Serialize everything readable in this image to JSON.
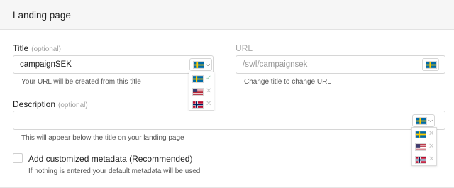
{
  "header": {
    "title": "Landing page"
  },
  "title_field": {
    "label": "Title",
    "optional": "(optional)",
    "value": "campaignSEK",
    "hint": "Your URL will be created from this title"
  },
  "url_field": {
    "label": "URL",
    "placeholder": "/sv/l/campaignsek",
    "hint": "Change title to change URL"
  },
  "description_field": {
    "label": "Description",
    "optional": "(optional)",
    "value": "",
    "hint": "This will appear below the title on your landing page"
  },
  "metadata": {
    "label": "Add customized metadata (Recommended)",
    "hint": "If nothing is entered your default metadata will be used",
    "checked": false
  },
  "languages": [
    {
      "icon": "sweden-flag-icon",
      "status": "done"
    },
    {
      "icon": "usa-flag-icon",
      "status": "missing"
    },
    {
      "icon": "norway-flag-icon",
      "status": "missing"
    }
  ],
  "status_marks": {
    "done": "✓",
    "missing": "✕"
  },
  "colors": {
    "header_bg": "#f6f6f6",
    "done_mark": "#9fd0b3",
    "missing_mark": "#c6c6c6"
  }
}
